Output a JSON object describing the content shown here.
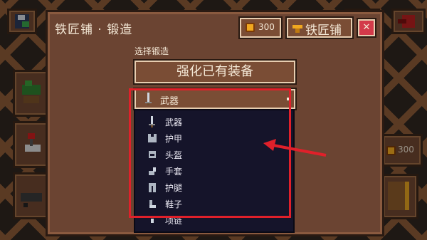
{
  "window": {
    "title": "铁匠铺 · 锻造",
    "coin_count": "300",
    "shop_button_label": "铁匠铺",
    "close_symbol": "✕"
  },
  "forge": {
    "select_label": "选择锻造",
    "upgrade_label": "强化已有装备"
  },
  "dropdown": {
    "selected": "武器",
    "items": [
      "武器",
      "护甲",
      "头盔",
      "手套",
      "护腿",
      "鞋子",
      "项链"
    ]
  },
  "background": {
    "coin_count": "300"
  },
  "colors": {
    "accent_red": "#e0202a",
    "panel": "#6b4432",
    "list_bg": "#15142a"
  }
}
